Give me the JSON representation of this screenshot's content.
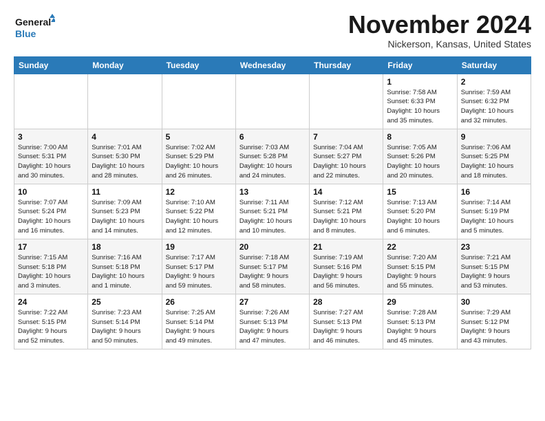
{
  "header": {
    "logo_line1": "General",
    "logo_line2": "Blue",
    "month": "November 2024",
    "location": "Nickerson, Kansas, United States"
  },
  "weekdays": [
    "Sunday",
    "Monday",
    "Tuesday",
    "Wednesday",
    "Thursday",
    "Friday",
    "Saturday"
  ],
  "weeks": [
    [
      {
        "day": "",
        "info": ""
      },
      {
        "day": "",
        "info": ""
      },
      {
        "day": "",
        "info": ""
      },
      {
        "day": "",
        "info": ""
      },
      {
        "day": "",
        "info": ""
      },
      {
        "day": "1",
        "info": "Sunrise: 7:58 AM\nSunset: 6:33 PM\nDaylight: 10 hours\nand 35 minutes."
      },
      {
        "day": "2",
        "info": "Sunrise: 7:59 AM\nSunset: 6:32 PM\nDaylight: 10 hours\nand 32 minutes."
      }
    ],
    [
      {
        "day": "3",
        "info": "Sunrise: 7:00 AM\nSunset: 5:31 PM\nDaylight: 10 hours\nand 30 minutes."
      },
      {
        "day": "4",
        "info": "Sunrise: 7:01 AM\nSunset: 5:30 PM\nDaylight: 10 hours\nand 28 minutes."
      },
      {
        "day": "5",
        "info": "Sunrise: 7:02 AM\nSunset: 5:29 PM\nDaylight: 10 hours\nand 26 minutes."
      },
      {
        "day": "6",
        "info": "Sunrise: 7:03 AM\nSunset: 5:28 PM\nDaylight: 10 hours\nand 24 minutes."
      },
      {
        "day": "7",
        "info": "Sunrise: 7:04 AM\nSunset: 5:27 PM\nDaylight: 10 hours\nand 22 minutes."
      },
      {
        "day": "8",
        "info": "Sunrise: 7:05 AM\nSunset: 5:26 PM\nDaylight: 10 hours\nand 20 minutes."
      },
      {
        "day": "9",
        "info": "Sunrise: 7:06 AM\nSunset: 5:25 PM\nDaylight: 10 hours\nand 18 minutes."
      }
    ],
    [
      {
        "day": "10",
        "info": "Sunrise: 7:07 AM\nSunset: 5:24 PM\nDaylight: 10 hours\nand 16 minutes."
      },
      {
        "day": "11",
        "info": "Sunrise: 7:09 AM\nSunset: 5:23 PM\nDaylight: 10 hours\nand 14 minutes."
      },
      {
        "day": "12",
        "info": "Sunrise: 7:10 AM\nSunset: 5:22 PM\nDaylight: 10 hours\nand 12 minutes."
      },
      {
        "day": "13",
        "info": "Sunrise: 7:11 AM\nSunset: 5:21 PM\nDaylight: 10 hours\nand 10 minutes."
      },
      {
        "day": "14",
        "info": "Sunrise: 7:12 AM\nSunset: 5:21 PM\nDaylight: 10 hours\nand 8 minutes."
      },
      {
        "day": "15",
        "info": "Sunrise: 7:13 AM\nSunset: 5:20 PM\nDaylight: 10 hours\nand 6 minutes."
      },
      {
        "day": "16",
        "info": "Sunrise: 7:14 AM\nSunset: 5:19 PM\nDaylight: 10 hours\nand 5 minutes."
      }
    ],
    [
      {
        "day": "17",
        "info": "Sunrise: 7:15 AM\nSunset: 5:18 PM\nDaylight: 10 hours\nand 3 minutes."
      },
      {
        "day": "18",
        "info": "Sunrise: 7:16 AM\nSunset: 5:18 PM\nDaylight: 10 hours\nand 1 minute."
      },
      {
        "day": "19",
        "info": "Sunrise: 7:17 AM\nSunset: 5:17 PM\nDaylight: 9 hours\nand 59 minutes."
      },
      {
        "day": "20",
        "info": "Sunrise: 7:18 AM\nSunset: 5:17 PM\nDaylight: 9 hours\nand 58 minutes."
      },
      {
        "day": "21",
        "info": "Sunrise: 7:19 AM\nSunset: 5:16 PM\nDaylight: 9 hours\nand 56 minutes."
      },
      {
        "day": "22",
        "info": "Sunrise: 7:20 AM\nSunset: 5:15 PM\nDaylight: 9 hours\nand 55 minutes."
      },
      {
        "day": "23",
        "info": "Sunrise: 7:21 AM\nSunset: 5:15 PM\nDaylight: 9 hours\nand 53 minutes."
      }
    ],
    [
      {
        "day": "24",
        "info": "Sunrise: 7:22 AM\nSunset: 5:15 PM\nDaylight: 9 hours\nand 52 minutes."
      },
      {
        "day": "25",
        "info": "Sunrise: 7:23 AM\nSunset: 5:14 PM\nDaylight: 9 hours\nand 50 minutes."
      },
      {
        "day": "26",
        "info": "Sunrise: 7:25 AM\nSunset: 5:14 PM\nDaylight: 9 hours\nand 49 minutes."
      },
      {
        "day": "27",
        "info": "Sunrise: 7:26 AM\nSunset: 5:13 PM\nDaylight: 9 hours\nand 47 minutes."
      },
      {
        "day": "28",
        "info": "Sunrise: 7:27 AM\nSunset: 5:13 PM\nDaylight: 9 hours\nand 46 minutes."
      },
      {
        "day": "29",
        "info": "Sunrise: 7:28 AM\nSunset: 5:13 PM\nDaylight: 9 hours\nand 45 minutes."
      },
      {
        "day": "30",
        "info": "Sunrise: 7:29 AM\nSunset: 5:12 PM\nDaylight: 9 hours\nand 43 minutes."
      }
    ]
  ]
}
